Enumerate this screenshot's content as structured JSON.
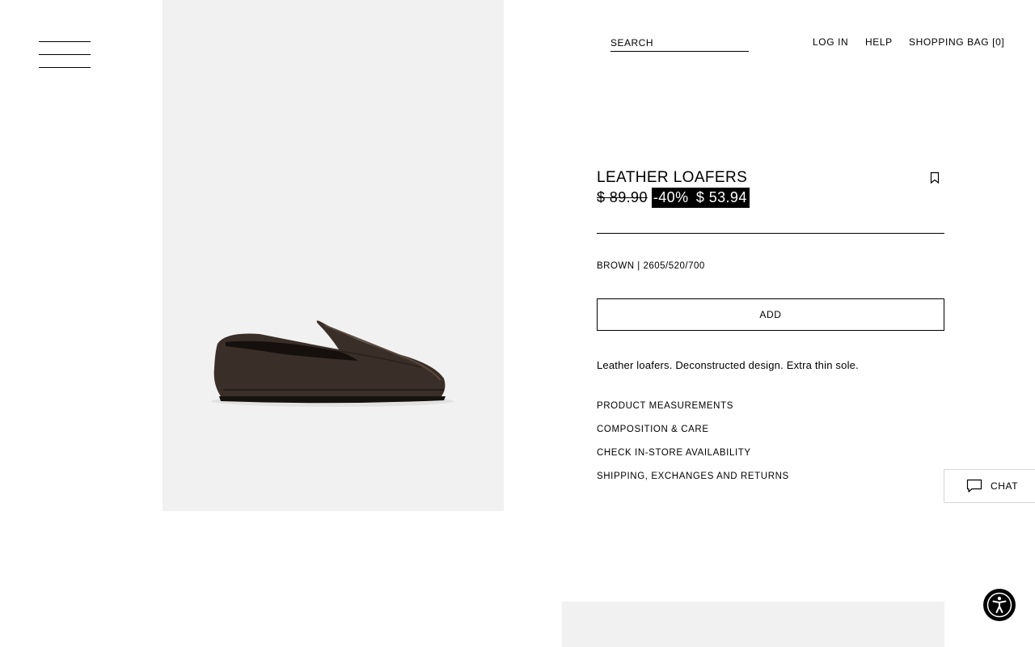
{
  "nav": {
    "menu_icon": "hamburger-menu-icon",
    "search_placeholder": "SEARCH",
    "login_label": "LOG IN",
    "help_label": "HELP",
    "bag_label": "SHOPPING BAG [0]"
  },
  "product": {
    "title": "LEATHER LOAFERS",
    "old_price": "$ 89.90",
    "discount": "-40%",
    "new_price": "$ 53.94",
    "color_ref": "BROWN | 2605/520/700",
    "add_label": "ADD",
    "description": "Leather loafers. Deconstructed design. Extra thin sole.",
    "info_links": [
      "PRODUCT MEASUREMENTS",
      "COMPOSITION & CARE",
      "CHECK IN-STORE AVAILABILITY",
      "SHIPPING, EXCHANGES AND RETURNS"
    ],
    "bookmark_icon": "bookmark-icon",
    "image_icon": "loafer-shoe-image"
  },
  "chat": {
    "label": "CHAT",
    "icon": "chat-bubble-icon"
  },
  "accessibility": {
    "icon": "accessibility-icon"
  },
  "colors": {
    "image_bg": "#f1f1f1",
    "text": "#000000",
    "discount_bg": "#000000",
    "discount_text": "#ffffff"
  }
}
